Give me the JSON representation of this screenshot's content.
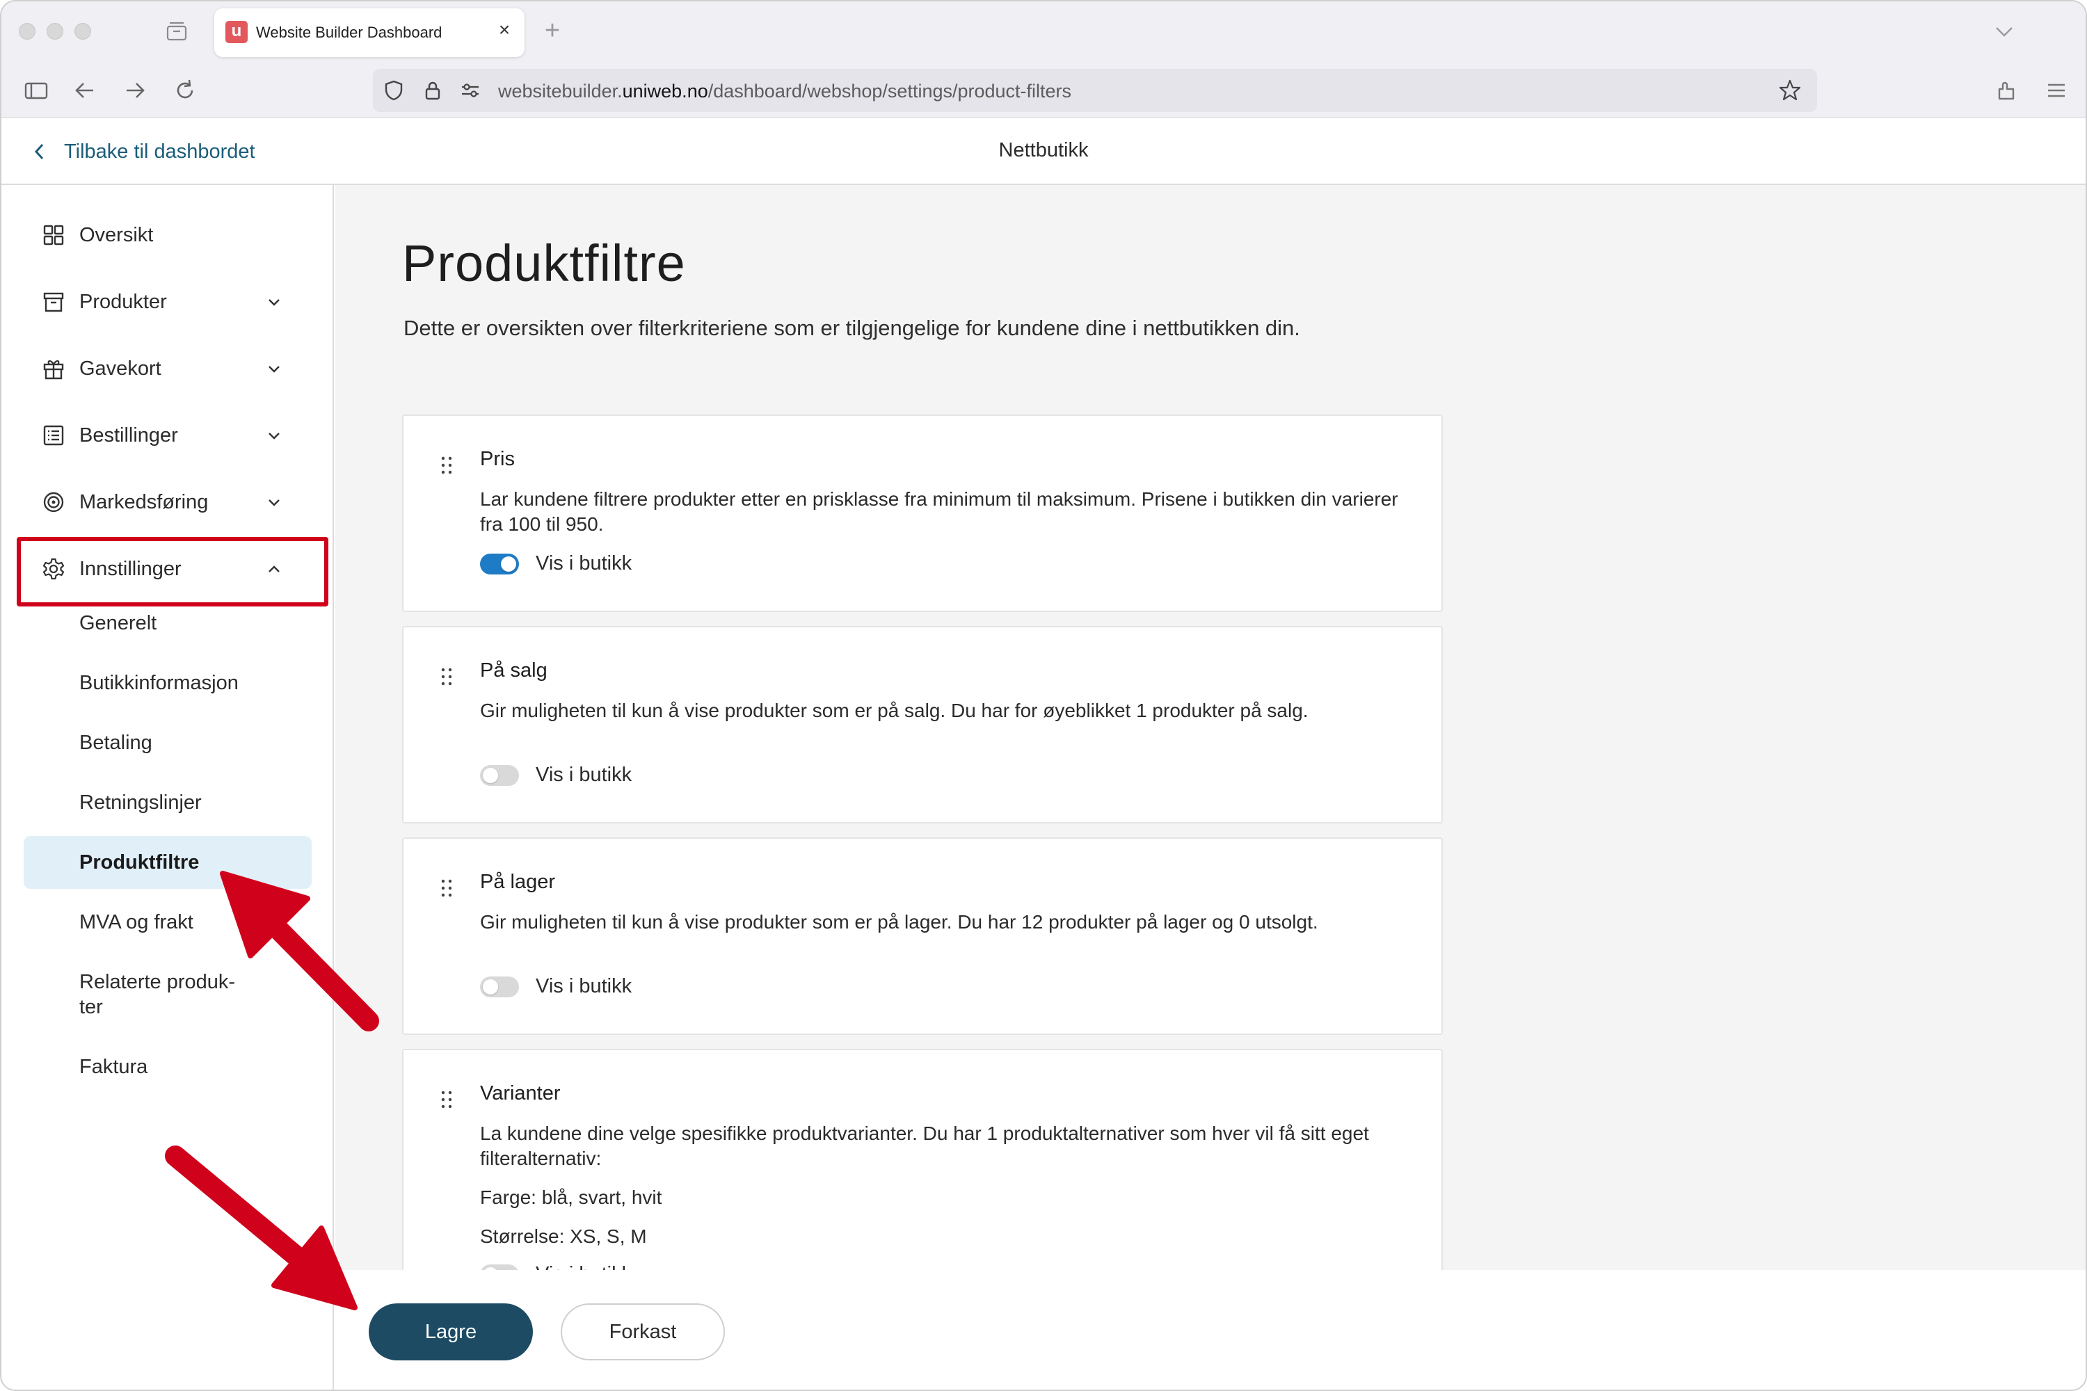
{
  "browser": {
    "tab_title": "Website Builder Dashboard",
    "tab_favicon_letter": "u",
    "tab_close": "×",
    "new_tab": "+",
    "url_prefix": "websitebuilder.",
    "url_domain": "uniweb.no",
    "url_path": "/dashboard/webshop/settings/product-filters"
  },
  "header": {
    "back_label": "Tilbake til dashbordet",
    "title": "Nettbutikk"
  },
  "sidebar": {
    "items": [
      {
        "label": "Oversikt",
        "icon": "grid-icon"
      },
      {
        "label": "Produkter",
        "icon": "archive-box-icon"
      },
      {
        "label": "Gavekort",
        "icon": "gift-icon"
      },
      {
        "label": "Bestillinger",
        "icon": "list-icon"
      },
      {
        "label": "Markedsføring",
        "icon": "target-icon"
      },
      {
        "label": "Innstillinger",
        "icon": "gear-icon"
      }
    ],
    "sub_items": [
      {
        "label": "Generelt"
      },
      {
        "label": "Butikkinformasjon"
      },
      {
        "label": "Betaling"
      },
      {
        "label": "Retningslinjer"
      },
      {
        "label": "Produktfiltre"
      },
      {
        "label": "MVA og frakt"
      },
      {
        "label": "Relaterte produk-"
      },
      {
        "label": "ter"
      },
      {
        "label": "Faktura"
      }
    ],
    "active_sub_item": "Produktfiltre"
  },
  "main": {
    "title": "Produktfiltre",
    "description": "Dette er oversikten over filterkriteriene som er tilgjengelige for kundene dine i nettbutikken din.",
    "filters": [
      {
        "title": "Pris",
        "description": "Lar kundene filtrere produkter etter en prisklasse fra minimum til maksimum. Prisene i butikken din varierer fra 100 til 950.",
        "toggle_label": "Vis i butikk",
        "enabled": true
      },
      {
        "title": "På salg",
        "description": "Gir muligheten til kun å vise produkter som er på salg. Du har for øyeblikket 1 produkter på salg.",
        "toggle_label": "Vis i butikk",
        "enabled": false
      },
      {
        "title": "På lager",
        "description": "Gir muligheten til kun å vise produkter som er på lager. Du har 12 produkter på lager og 0 utsolgt.",
        "toggle_label": "Vis i butikk",
        "enabled": false
      },
      {
        "title": "Varianter",
        "description": "La kundene dine velge spesifikke produktvarianter. Du har 1 produktalternativer som hver vil få sitt eget filteralternativ:",
        "extra_lines": [
          "Farge: blå, svart, hvit",
          "Størrelse: XS, S, M"
        ],
        "toggle_label": "Vis i butikk",
        "enabled": false
      }
    ]
  },
  "footer": {
    "save_label": "Lagre",
    "cancel_label": "Forkast"
  },
  "colors": {
    "accent": "#1c4b63",
    "toggle_on": "#1e7bc6",
    "annotation_red": "#d0021b",
    "active_bg": "#e1eff8"
  }
}
